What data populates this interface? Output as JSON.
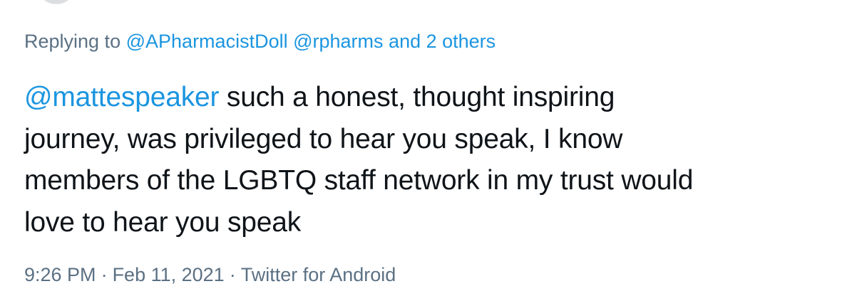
{
  "replying": {
    "prefix": "Replying to",
    "handle_1": "@APharmacistDoll",
    "handle_2": "@rpharms",
    "others": "and 2 others"
  },
  "tweet": {
    "mention": "@mattespeaker",
    "line_1_rest": " such a honest, thought inspiring",
    "line_2": "journey, was privileged to hear you speak, I know",
    "line_3": "members of the LGBTQ staff network in my trust would",
    "line_4": "love to hear you speak"
  },
  "meta": {
    "time": "9:26 PM",
    "separator": "·",
    "date": "Feb 11, 2021",
    "source": "Twitter for Android"
  },
  "colors": {
    "link": "#1b95e0",
    "secondary_text": "#5b7083",
    "primary_text": "#0f1419"
  }
}
